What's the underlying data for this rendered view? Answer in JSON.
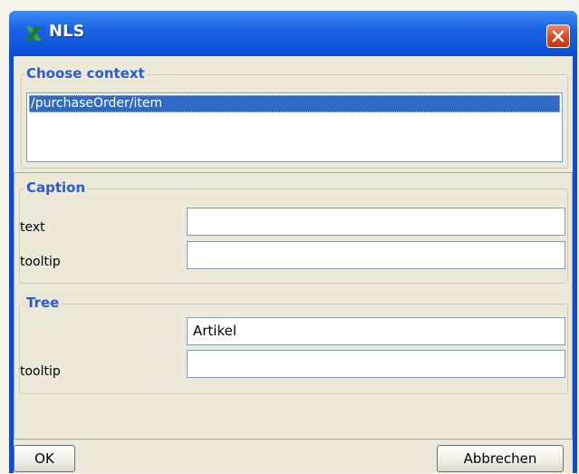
{
  "window": {
    "title": "NLS",
    "app_icon": "xml-spy-x-icon",
    "close_icon": "close-icon"
  },
  "context": {
    "legend": "Choose context",
    "items": [
      "/purchaseOrder/item"
    ]
  },
  "caption": {
    "legend": "Caption",
    "text_label": "text",
    "text_value": "",
    "tooltip_label": "tooltip",
    "tooltip_value": ""
  },
  "tree": {
    "legend": "Tree",
    "text_value": "Artikel",
    "tooltip_label": "tooltip",
    "tooltip_value": ""
  },
  "buttons": {
    "ok": "OK",
    "cancel": "Abbrechen"
  },
  "colors": {
    "titlebar": "#0b4fd0",
    "legend_text": "#2a5bd6",
    "selection": "#316ac5",
    "close_button": "#d2431d"
  }
}
